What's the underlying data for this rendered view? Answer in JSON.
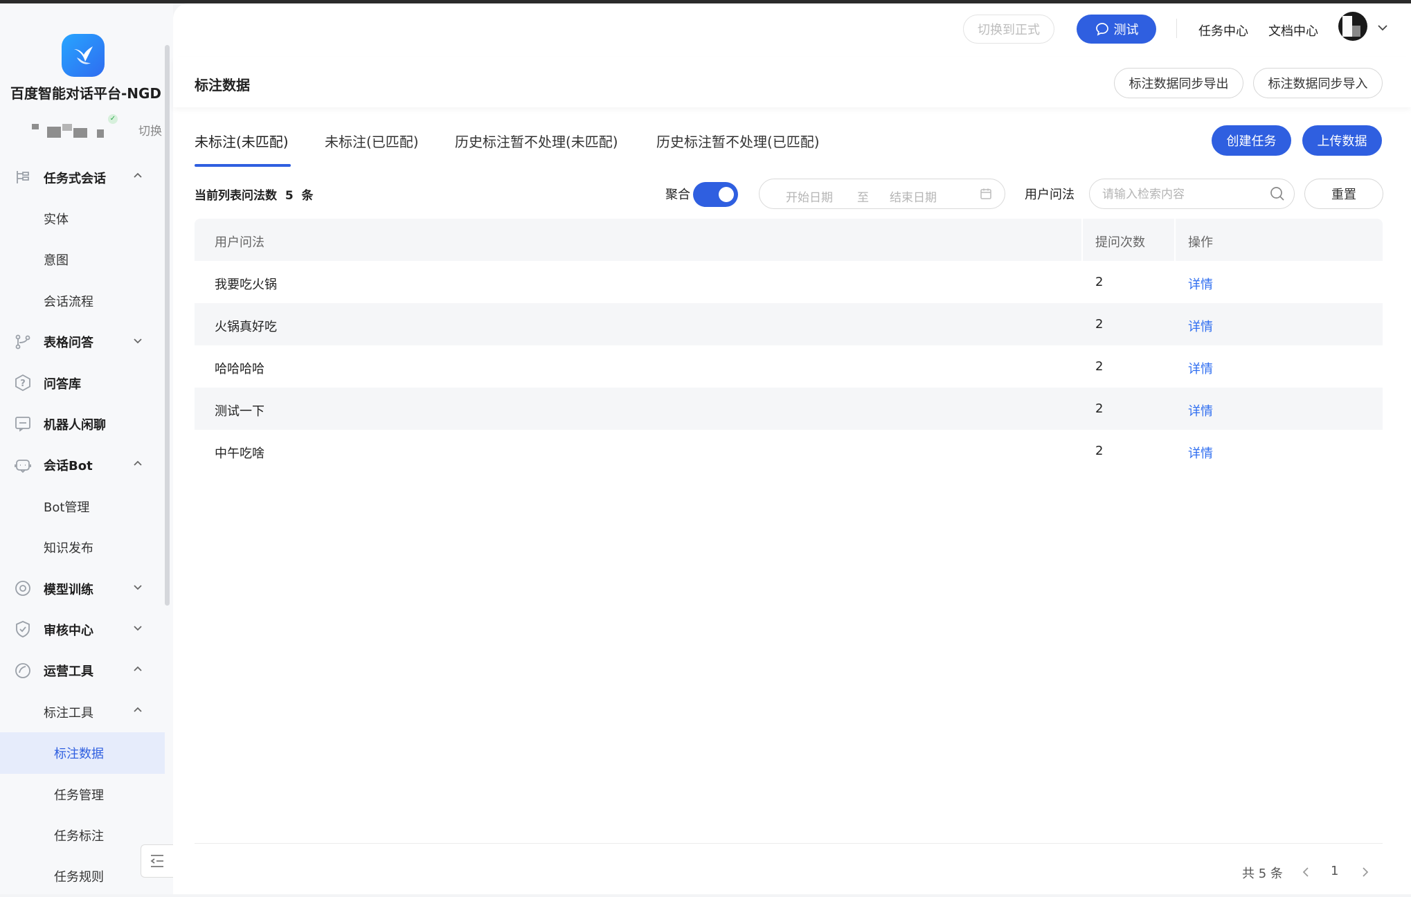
{
  "sidebar": {
    "platform_name": "百度智能对话平台-NGD",
    "switch_label": "切换",
    "menu": [
      {
        "label": "任务式会话",
        "level": "top",
        "expanded": true
      },
      {
        "label": "实体",
        "level": "sub"
      },
      {
        "label": "意图",
        "level": "sub"
      },
      {
        "label": "会话流程",
        "level": "sub"
      },
      {
        "label": "表格问答",
        "level": "top",
        "expanded": false
      },
      {
        "label": "问答库",
        "level": "top"
      },
      {
        "label": "机器人闲聊",
        "level": "top"
      },
      {
        "label": "会话Bot",
        "level": "top",
        "expanded": true
      },
      {
        "label": "Bot管理",
        "level": "sub"
      },
      {
        "label": "知识发布",
        "level": "sub"
      },
      {
        "label": "模型训练",
        "level": "top",
        "expanded": false
      },
      {
        "label": "审核中心",
        "level": "top",
        "expanded": false
      },
      {
        "label": "运营工具",
        "level": "top",
        "expanded": true
      },
      {
        "label": "标注工具",
        "level": "sub",
        "expanded": true
      },
      {
        "label": "标注数据",
        "level": "sub2",
        "active": true
      },
      {
        "label": "任务管理",
        "level": "sub2"
      },
      {
        "label": "任务标注",
        "level": "sub2"
      },
      {
        "label": "任务规则",
        "level": "sub2"
      }
    ]
  },
  "header": {
    "switch_formal": "切换到正式",
    "test_button": "测试",
    "task_center": "任务中心",
    "doc_center": "文档中心"
  },
  "page": {
    "title": "标注数据",
    "export_button": "标注数据同步导出",
    "import_button": "标注数据同步导入"
  },
  "tabs": [
    {
      "label": "未标注(未匹配)",
      "active": true
    },
    {
      "label": "未标注(已匹配)"
    },
    {
      "label": "历史标注暂不处理(未匹配)"
    },
    {
      "label": "历史标注暂不处理(已匹配)"
    }
  ],
  "actions": {
    "create_task": "创建任务",
    "upload_data": "上传数据"
  },
  "filters": {
    "count_text": "当前列表问法数  5  条",
    "aggregate_label": "聚合",
    "aggregate_on": true,
    "start_date_placeholder": "开始日期",
    "date_to": "至",
    "end_date_placeholder": "结束日期",
    "user_query_label": "用户问法",
    "search_placeholder": "请输入检索内容",
    "reset_button": "重置"
  },
  "table": {
    "columns": [
      "用户问法",
      "提问次数",
      "操作"
    ],
    "rows": [
      {
        "query": "我要吃火锅",
        "count": "2",
        "action": "详情"
      },
      {
        "query": "火锅真好吃",
        "count": "2",
        "action": "详情"
      },
      {
        "query": "哈哈哈哈",
        "count": "2",
        "action": "详情"
      },
      {
        "query": "测试一下",
        "count": "2",
        "action": "详情"
      },
      {
        "query": "中午吃啥",
        "count": "2",
        "action": "详情"
      }
    ]
  },
  "pagination": {
    "total_text": "共 5 条",
    "current_page": "1"
  },
  "colors": {
    "primary": "#2f5fe0",
    "link": "#2f6ef0"
  }
}
